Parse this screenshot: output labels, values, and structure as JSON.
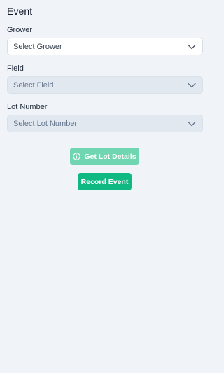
{
  "header": {
    "title": "Event"
  },
  "form": {
    "grower": {
      "label": "Grower",
      "placeholder": "Select Grower"
    },
    "field": {
      "label": "Field",
      "placeholder": "Select Field"
    },
    "lot_number": {
      "label": "Lot Number",
      "placeholder": "Select Lot Number"
    }
  },
  "actions": {
    "get_lot_details_label": "Get Lot Details",
    "record_event_label": "Record Event"
  },
  "icons": {
    "dropdown": "chevron-down-icon",
    "info": "info-icon"
  },
  "colors": {
    "accent": "#10b981",
    "accent_disabled": "#6fd6b1",
    "background": "#f0f4f8",
    "disabled_select": "#e2e8f0"
  }
}
